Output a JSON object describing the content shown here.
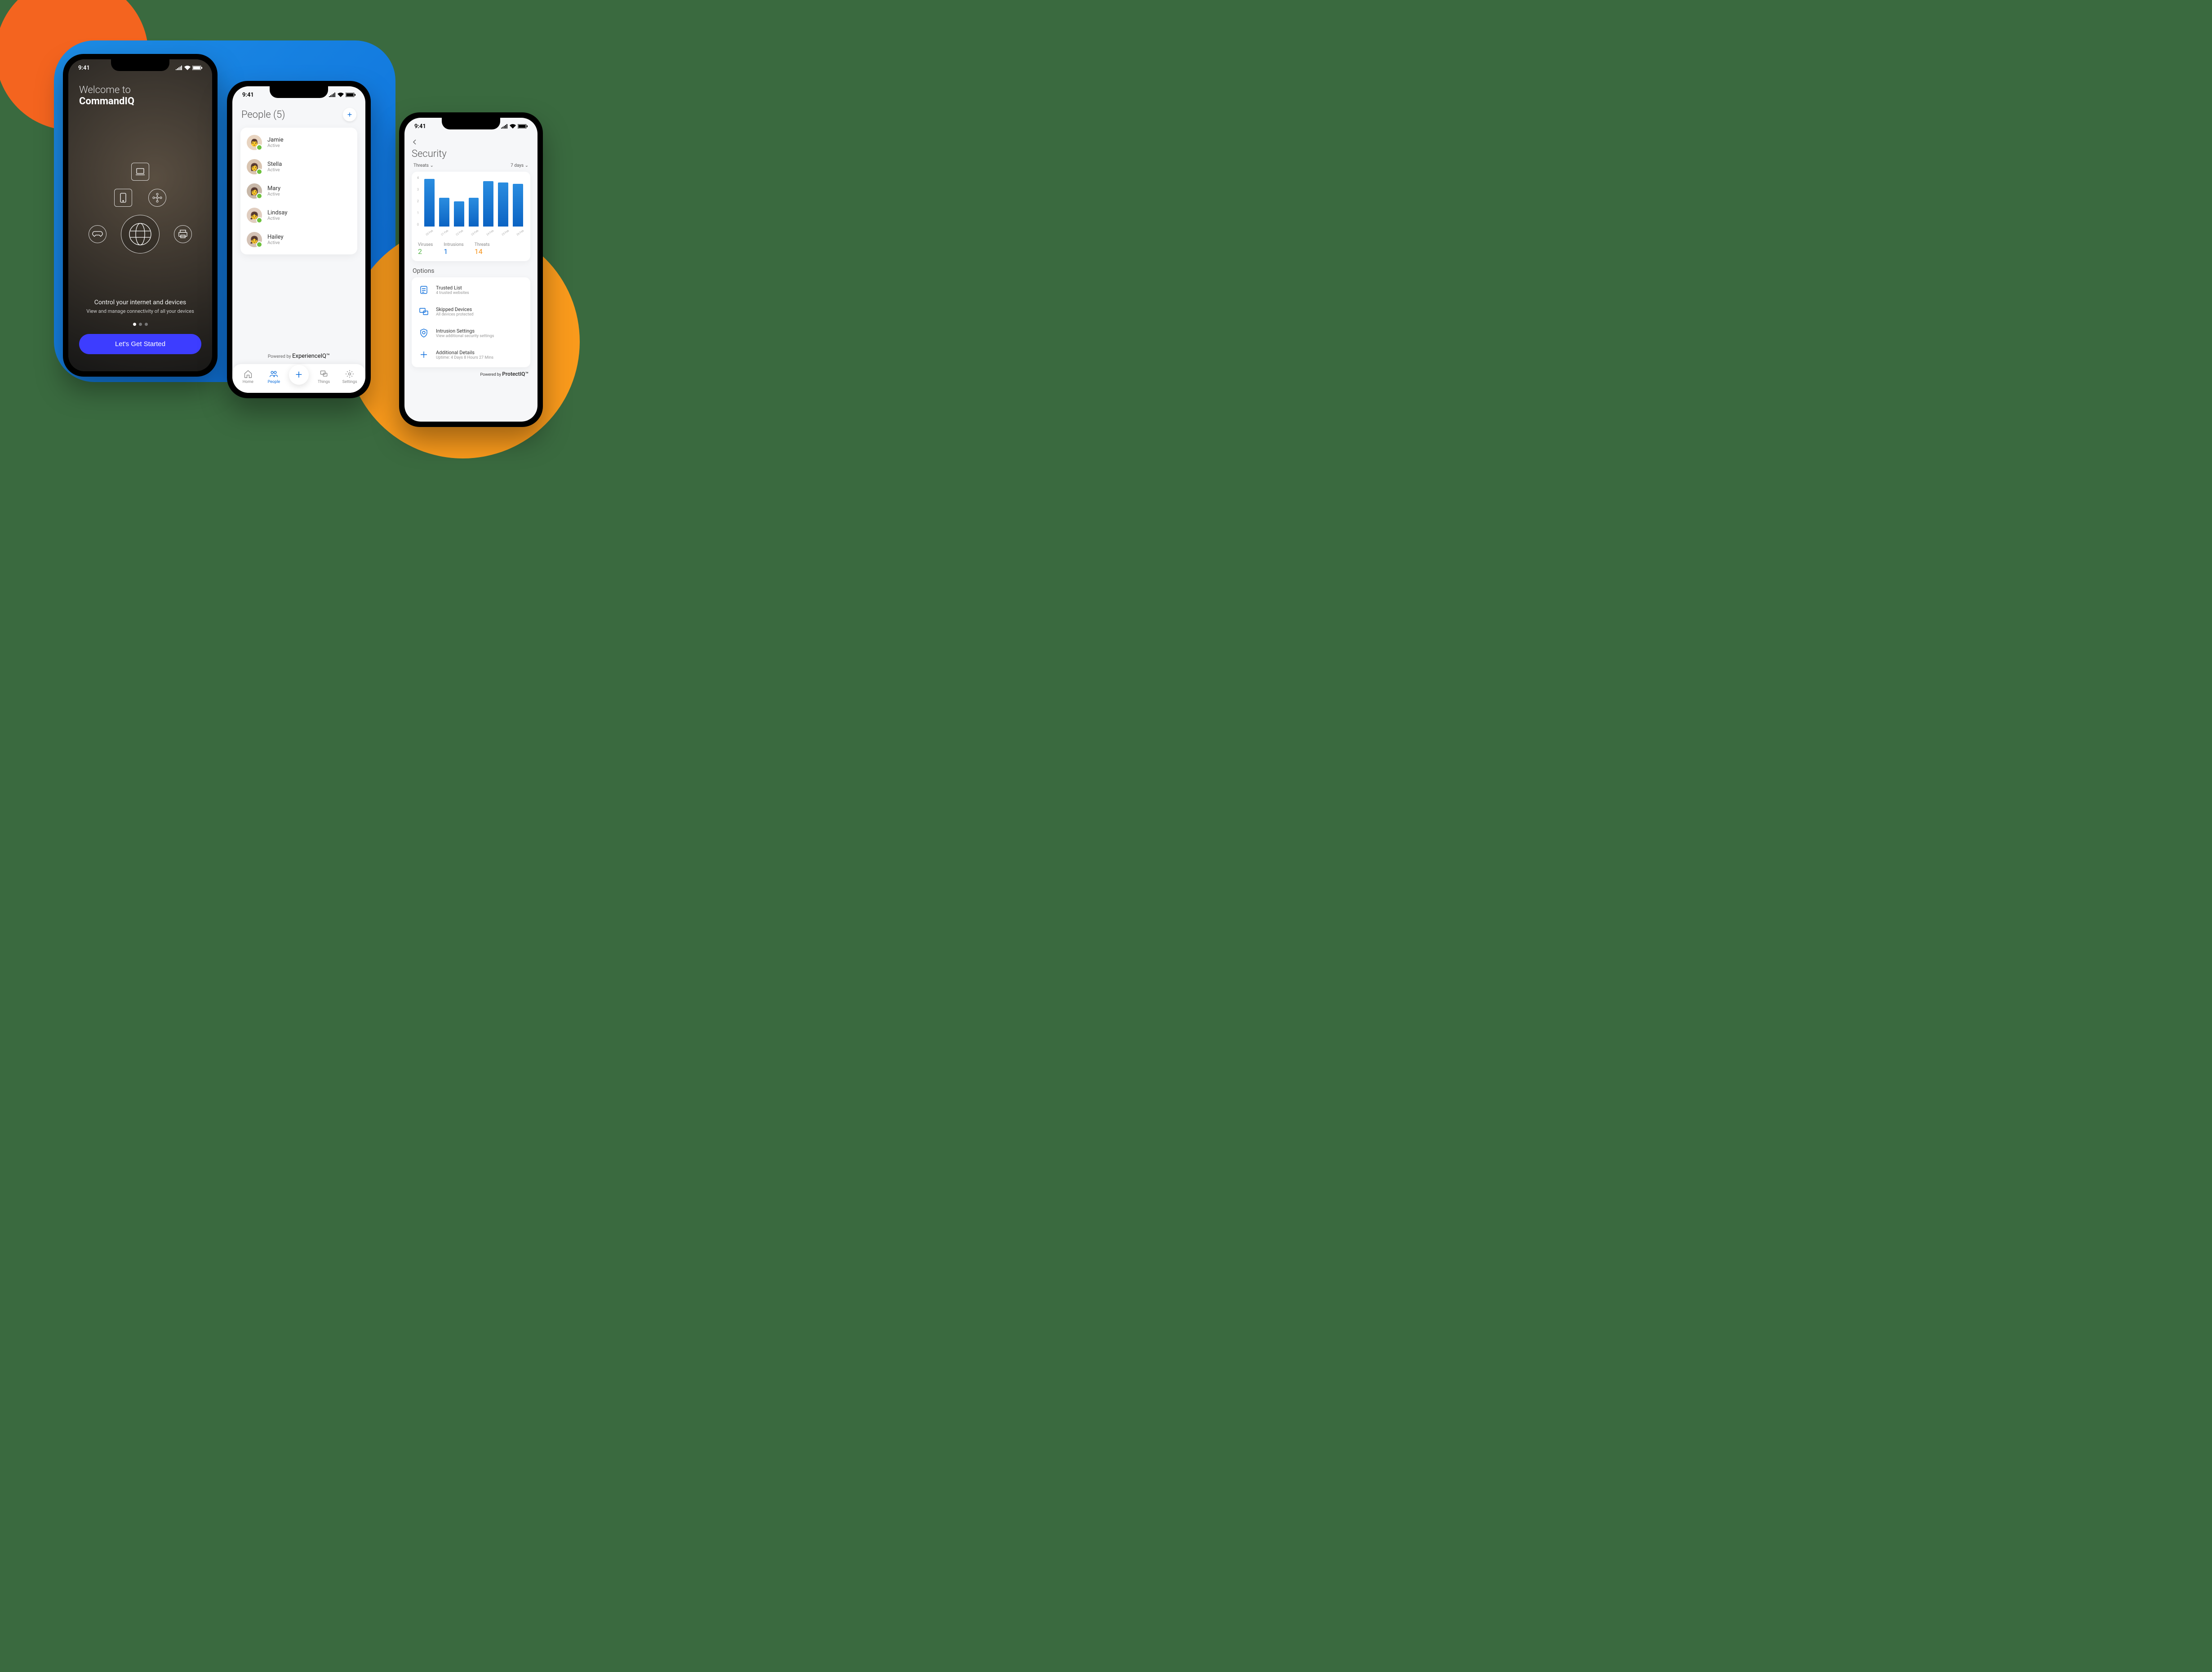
{
  "status": {
    "time": "9:41"
  },
  "phone1": {
    "welcome_pre": "Welcome to",
    "app_name": "CommandIQ",
    "tagline": "Control your internet and devices",
    "subtagline": "View and manage connectivity of all your devices",
    "cta": "Let's Get Started"
  },
  "phone2": {
    "title": "People (5)",
    "people": [
      {
        "name": "Jamie",
        "status": "Active"
      },
      {
        "name": "Stella",
        "status": "Active"
      },
      {
        "name": "Mary",
        "status": "Active"
      },
      {
        "name": "Lindsay",
        "status": "Active"
      },
      {
        "name": "Hailey",
        "status": "Active"
      }
    ],
    "powered_prefix": "Powered by ",
    "powered_brand": "ExperienceIQ™",
    "nav": {
      "home": "Home",
      "people": "People",
      "things": "Things",
      "settings": "Settings"
    }
  },
  "phone3": {
    "title": "Security",
    "filter_left": "Threats",
    "filter_right": "7 days",
    "stats": {
      "viruses_label": "Viruses",
      "viruses_val": "2",
      "intrusions_label": "Intrusions",
      "intrusions_val": "1",
      "threats_label": "Threats",
      "threats_val": "14"
    },
    "options_title": "Options",
    "options": [
      {
        "title": "Trusted List",
        "sub": "4 trusted websites"
      },
      {
        "title": "Skipped Devices",
        "sub": "All devices protected"
      },
      {
        "title": "Intrusion Settings",
        "sub": "View additional security settings"
      },
      {
        "title": "Additional Details",
        "sub": "Uptime: 4 Days 8 Hours 27 Mins"
      }
    ],
    "powered_prefix": "Powered by ",
    "powered_brand": "ProtectIQ™"
  },
  "chart_data": {
    "type": "bar",
    "title": "Threats (7 days)",
    "xlabel": "",
    "ylabel": "",
    "ylim": [
      0,
      4
    ],
    "categories": [
      "20 Feb",
      "21 Feb",
      "22 Feb",
      "23 Feb",
      "24 Feb",
      "25 Feb",
      "26 Feb"
    ],
    "values": [
      3.8,
      2.3,
      2.0,
      2.3,
      3.6,
      3.5,
      3.4
    ]
  }
}
